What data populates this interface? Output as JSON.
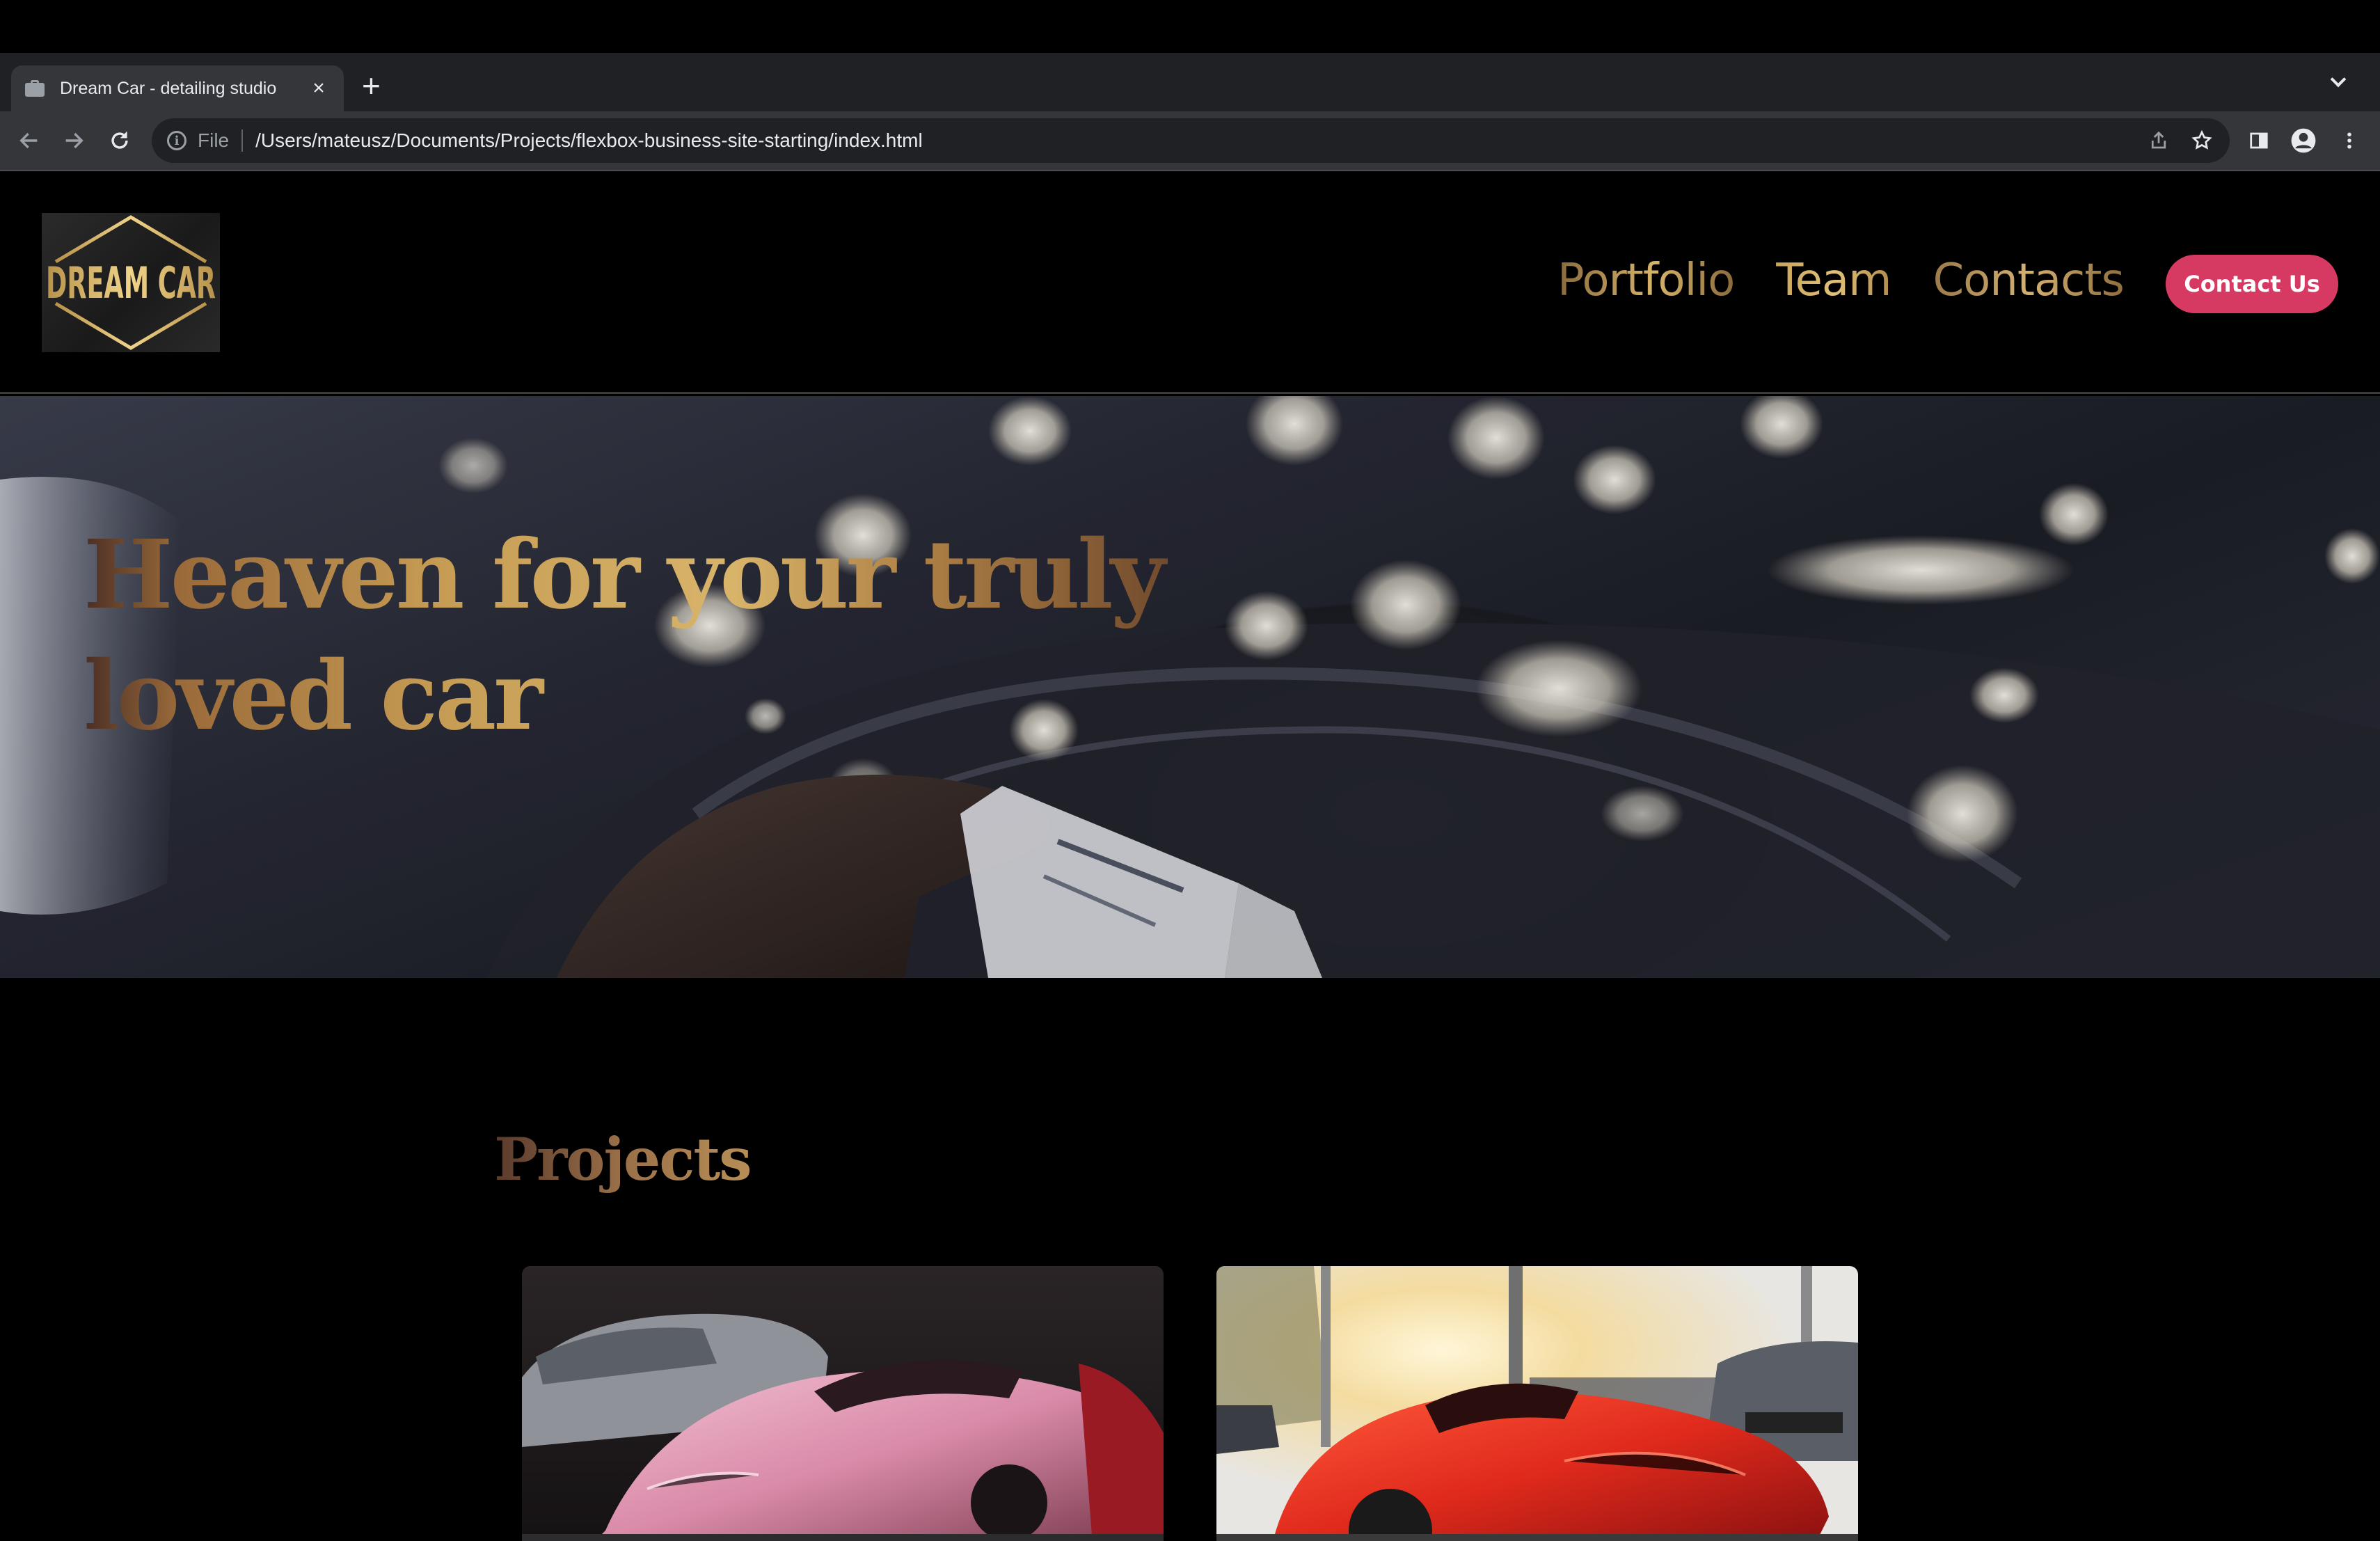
{
  "browser": {
    "tab_title": "Dream Car - detailing studio",
    "tab_close": "×",
    "new_tab": "+",
    "url_scheme": "File",
    "url_path": "/Users/mateusz/Documents/Projects/flexbox-business-site-starting/index.html",
    "icons": [
      "back-icon",
      "forward-icon",
      "reload-icon",
      "info-icon",
      "share-icon",
      "bookmark-star-icon",
      "side-panel-icon",
      "profile-icon",
      "menu-kebab-icon"
    ]
  },
  "site": {
    "logo_text": "DREAM CAR",
    "nav": [
      "Portfolio",
      "Team",
      "Contacts"
    ],
    "cta_label": "Contact Us",
    "hero_title": "Heaven for your truly loved car",
    "projects_title": "Projects"
  }
}
